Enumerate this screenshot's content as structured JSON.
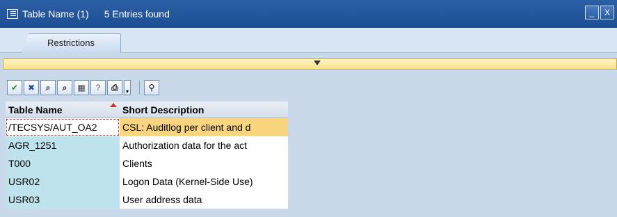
{
  "window": {
    "title": "Table Name (1)",
    "count_text": "5 Entries found",
    "minimize_glyph": "_",
    "close_glyph": "X"
  },
  "tabs": [
    {
      "label": "Restrictions"
    }
  ],
  "toolbar": {
    "buttons": [
      {
        "name": "continue-icon",
        "glyph": "✔",
        "color": "#1d8a2a"
      },
      {
        "name": "cancel-icon",
        "glyph": "✖",
        "color": "#1f4fa0"
      },
      {
        "name": "find-icon",
        "glyph": "⌕",
        "color": "#333333"
      },
      {
        "name": "find-next-icon",
        "glyph": "⌕",
        "color": "#333333"
      },
      {
        "name": "sort-icon",
        "glyph": "▦",
        "color": "#444444"
      },
      {
        "name": "help-icon",
        "glyph": "?",
        "color": "#888888"
      },
      {
        "name": "print-icon",
        "glyph": "⎙",
        "color": "#222222"
      }
    ],
    "extra_glyph": "▾",
    "filter_glyph": "⚲"
  },
  "table": {
    "columns": [
      "Table Name",
      "Short Description"
    ],
    "rows": [
      {
        "name": "/TECSYS/AUT_OA2",
        "desc": "CSL: Auditlog per client and d",
        "selected": true
      },
      {
        "name": "AGR_1251",
        "desc": "Authorization data for the act",
        "selected": false
      },
      {
        "name": "T000",
        "desc": "Clients",
        "selected": false
      },
      {
        "name": "USR02",
        "desc": "Logon Data (Kernel-Side Use)",
        "selected": false
      },
      {
        "name": "USR03",
        "desc": "User address data",
        "selected": false
      }
    ]
  },
  "colors": {
    "titlebar": "#1e4e93",
    "selected_row": "#f9d580",
    "key_column": "#bfe3ec"
  }
}
